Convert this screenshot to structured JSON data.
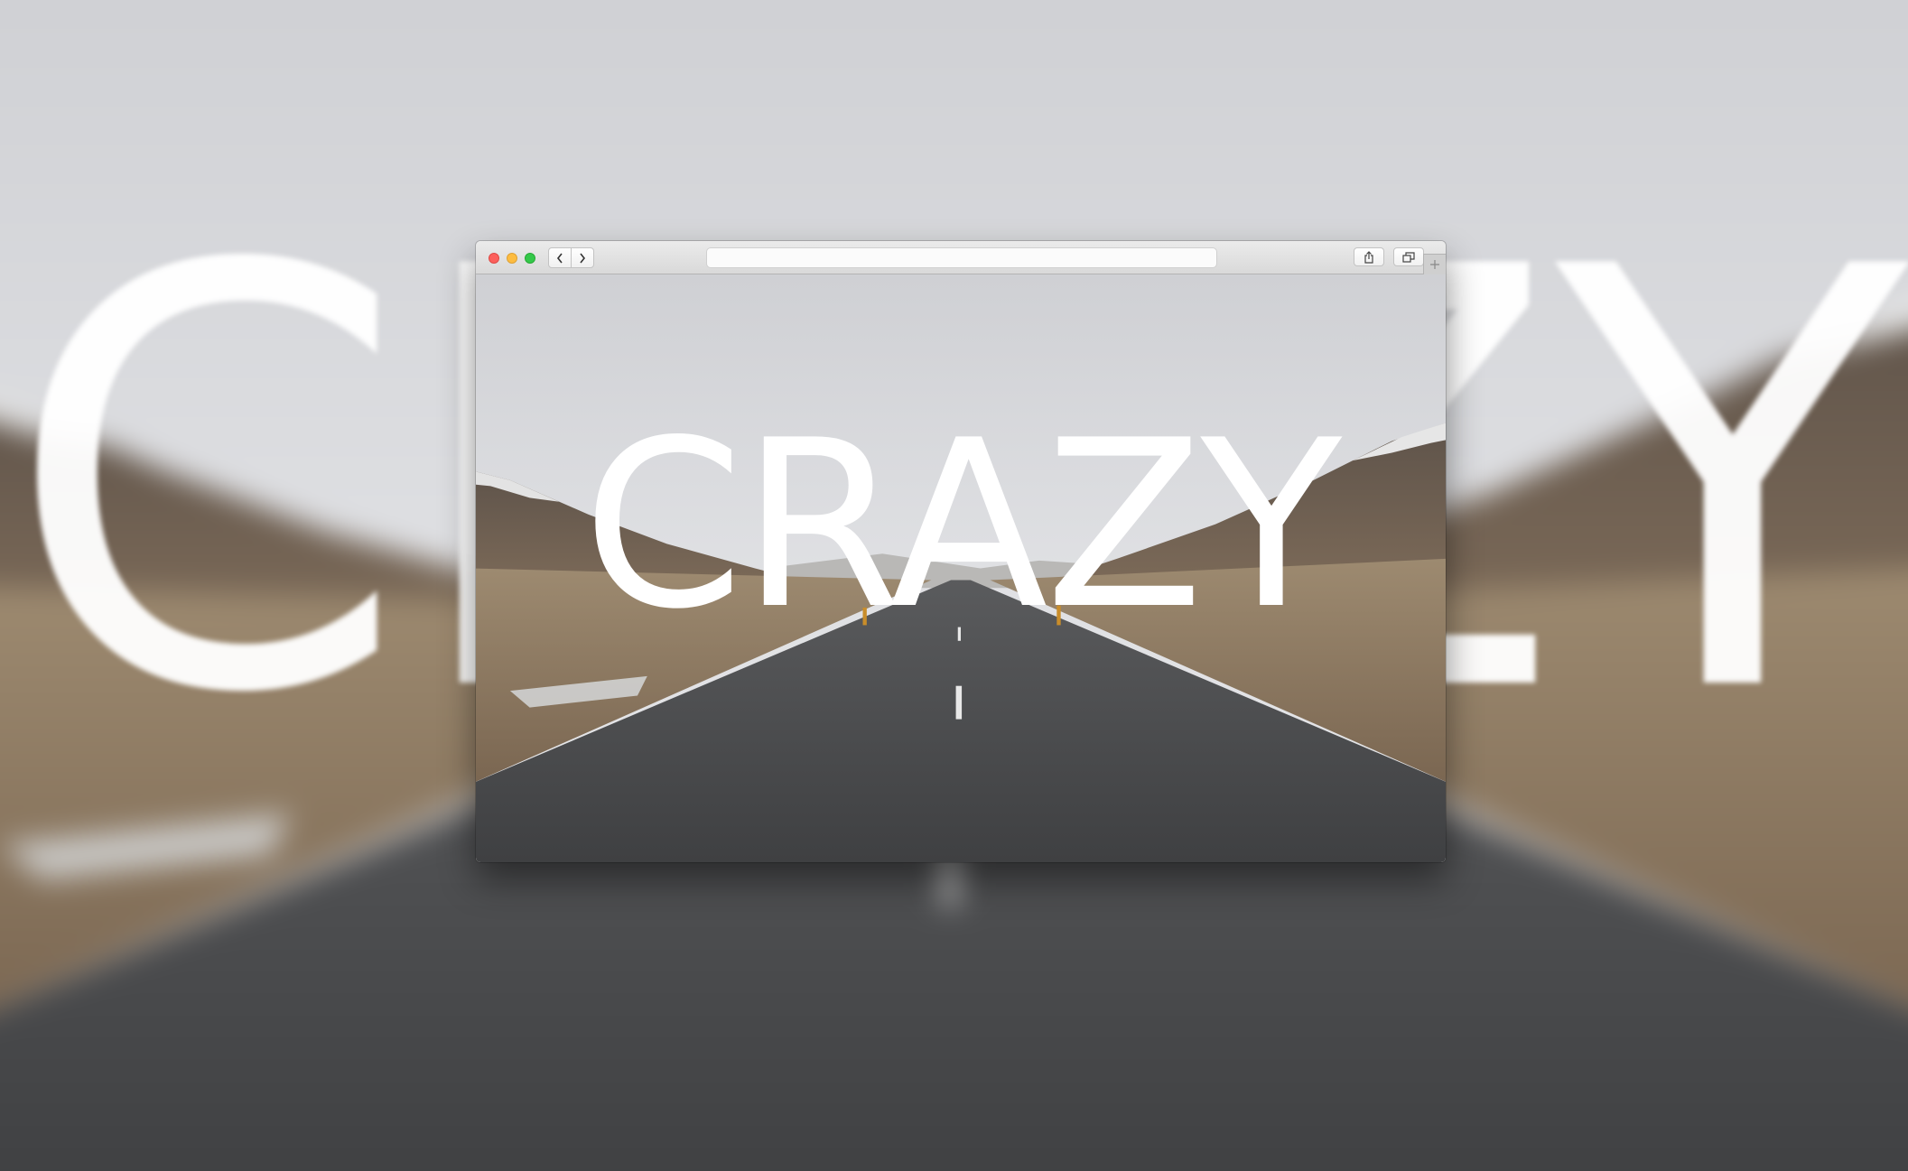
{
  "page": {
    "headline": "CRAZY",
    "background_headline": "CRAZY"
  },
  "browser": {
    "traffic_lights": [
      "close-button",
      "minimize-button",
      "zoom-button"
    ],
    "navigation": [
      "chevron-left-icon",
      "chevron-right-icon"
    ],
    "address": "",
    "toolbar_icons": [
      "share-icon",
      "tabs-overview-icon"
    ],
    "new_tab_icon": "plus-icon"
  },
  "photo": {
    "subject": "road-through-valley-icon",
    "colors": {
      "sky": "#d7d8dc",
      "mountains": "#6b5a4c",
      "grass": "#9a8266",
      "road": "#4a4b4d",
      "text": "#ffffff"
    }
  }
}
